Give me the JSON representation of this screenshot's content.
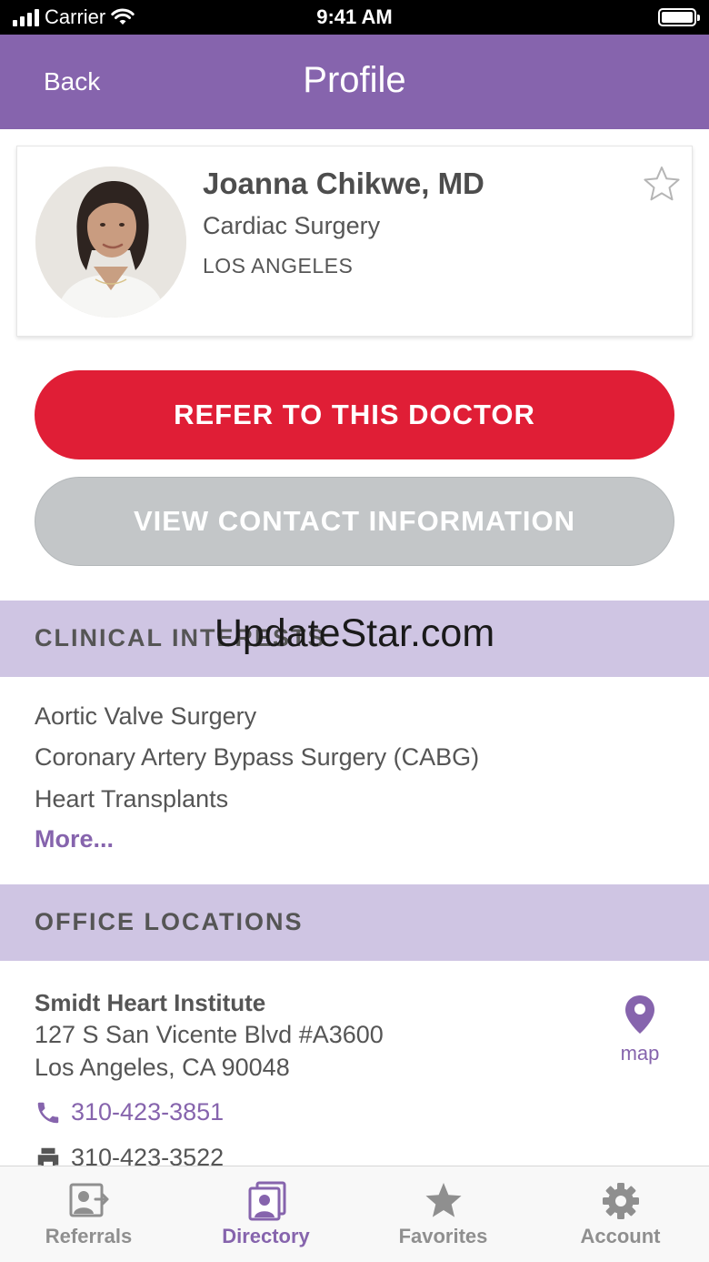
{
  "status_bar": {
    "carrier": "Carrier",
    "time": "9:41 AM"
  },
  "nav": {
    "back_label": "Back",
    "title": "Profile"
  },
  "doctor": {
    "name": "Joanna Chikwe, MD",
    "specialty": "Cardiac Surgery",
    "city": "LOS ANGELES",
    "favorite_icon": "star-outline-icon"
  },
  "actions": {
    "refer_label": "REFER TO THIS DOCTOR",
    "contact_label": "VIEW CONTACT INFORMATION"
  },
  "clinical_interests": {
    "header": "CLINICAL INTERESTS",
    "items": [
      "Aortic Valve Surgery",
      "Coronary Artery Bypass Surgery (CABG)",
      "Heart Transplants"
    ],
    "more_label": "More..."
  },
  "watermark": "UpdateStar.com",
  "office_locations": {
    "header": "OFFICE LOCATIONS",
    "location": {
      "name": "Smidt Heart Institute",
      "address_line1": "127 S San Vicente Blvd #A3600",
      "address_line2": "Los Angeles, CA 90048",
      "phone": "310-423-3851",
      "fax": "310-423-3522",
      "map_label": "map"
    }
  },
  "tab_bar": {
    "items": [
      {
        "label": "Referrals",
        "icon": "referrals-icon",
        "active": false
      },
      {
        "label": "Directory",
        "icon": "directory-icon",
        "active": true
      },
      {
        "label": "Favorites",
        "icon": "star-icon",
        "active": false
      },
      {
        "label": "Account",
        "icon": "gear-icon",
        "active": false
      }
    ]
  },
  "colors": {
    "brand_purple": "#8664ad",
    "section_lavender": "#cfc5e3",
    "refer_red": "#e01e36",
    "contact_gray": "#c3c6c8",
    "tab_inactive": "#8f8f8f"
  }
}
